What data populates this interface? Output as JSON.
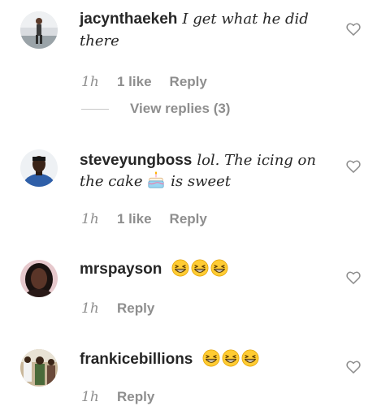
{
  "comments": [
    {
      "username": "jacynthaekeh",
      "text_line1": "I get what he did",
      "text_line2": "there",
      "time": "1h",
      "likes": "1 like",
      "reply": "Reply",
      "view_replies": "View replies (3)"
    },
    {
      "username": "steveyungboss",
      "text_line1": "lol. The icing on",
      "text_line2_pre": "the cake",
      "text_line2_post": "is sweet",
      "time": "1h",
      "likes": "1 like",
      "reply": "Reply"
    },
    {
      "username": "mrspayson",
      "time": "1h",
      "reply": "Reply"
    },
    {
      "username": "frankicebillions",
      "time": "1h",
      "reply": "Reply"
    }
  ],
  "icons": {
    "like": "heart-outline-icon",
    "emoji_laugh": "grinning-squinting-face",
    "emoji_cake": "birthday-cake"
  },
  "colors": {
    "text": "#262626",
    "secondary": "#8e8e8e",
    "background": "#ffffff"
  }
}
